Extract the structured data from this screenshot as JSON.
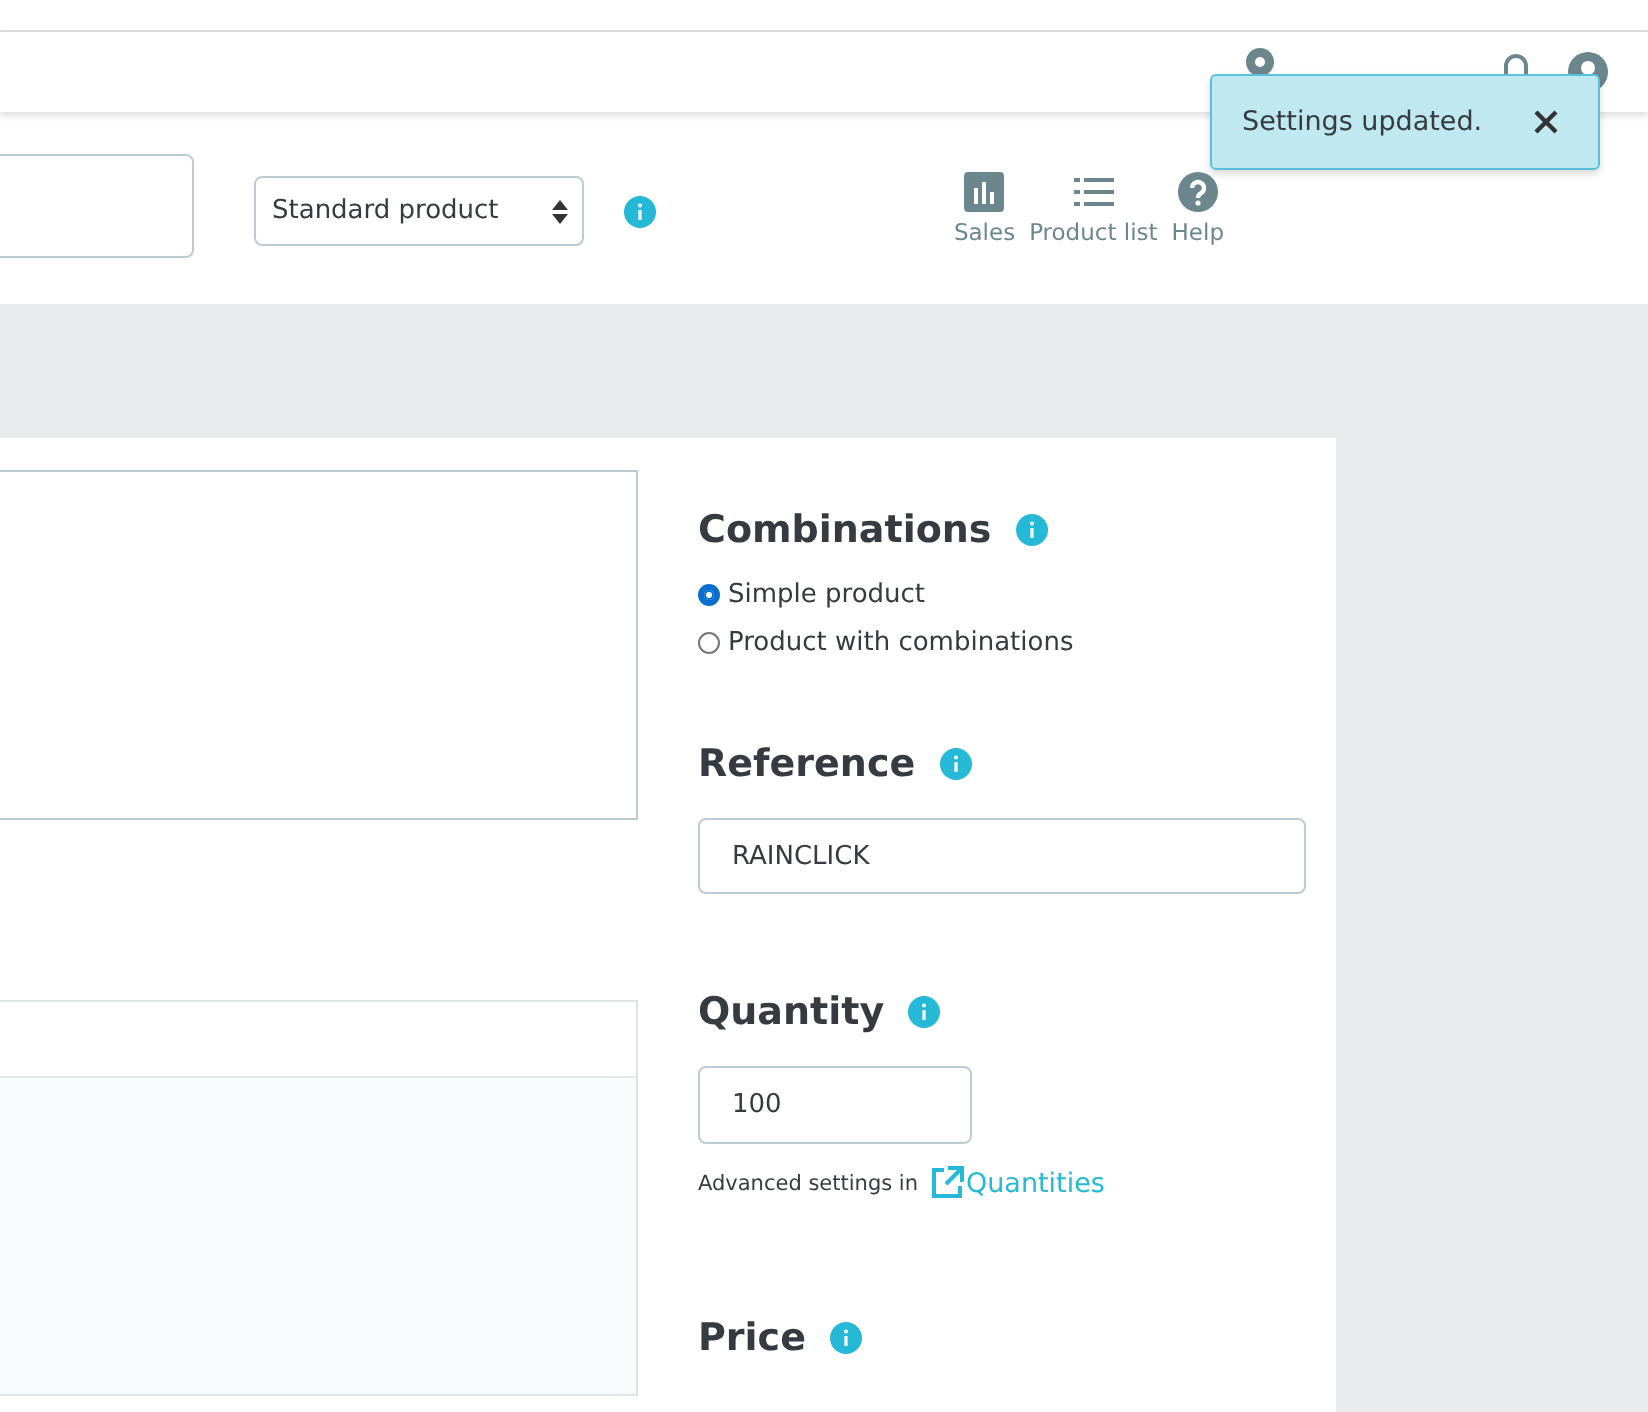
{
  "toolbar": {
    "product_type": "Standard product",
    "actions": [
      {
        "kind": "sales",
        "label": "Sales"
      },
      {
        "kind": "list",
        "label": "Product list"
      },
      {
        "kind": "help",
        "label": "Help"
      }
    ]
  },
  "toast": {
    "message": "Settings updated."
  },
  "form": {
    "combinations": {
      "title": "Combinations",
      "options": [
        {
          "label": "Simple product",
          "selected": true
        },
        {
          "label": "Product with combinations",
          "selected": false
        }
      ]
    },
    "reference": {
      "title": "Reference",
      "value": "RAINCLICK"
    },
    "quantity": {
      "title": "Quantity",
      "value": "100",
      "note": "Advanced settings in",
      "link": "Quantities"
    },
    "price": {
      "title": "Price"
    }
  }
}
